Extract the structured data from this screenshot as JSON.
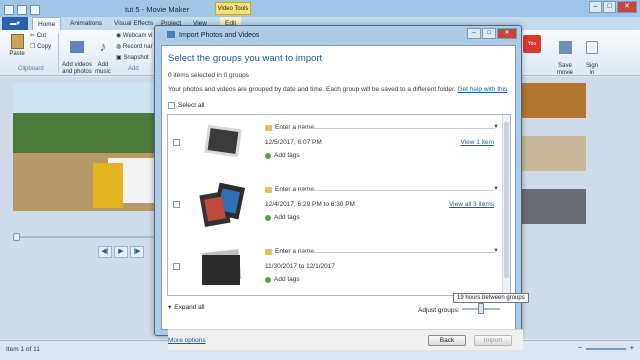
{
  "app": {
    "title": "tut 5 - Movie Maker",
    "video_tools": "Video Tools"
  },
  "tabs": [
    "Home",
    "Animations",
    "Visual Effects",
    "Project",
    "View",
    "Edit"
  ],
  "ribbon": {
    "paste": "Paste",
    "cut": "Cut",
    "copy": "Copy",
    "add_videos": "Add videos\nand photos",
    "add_music": "Add\nmusic",
    "webcam": "Webcam vi",
    "record": "Record nar",
    "snapshot": "Snapshot",
    "save_movie": "Save\nmovie",
    "sign_in": "Sign\nin",
    "clipboard_group": "Clipboard",
    "add_group": "Add"
  },
  "status": {
    "item": "Item 1 of 11"
  },
  "dialog": {
    "title": "Import Photos and Videos",
    "heading": "Select the groups you want to import",
    "selected": "0 items selected in 0 groups",
    "info": "Your photos and videos are grouped by date and time. Each group will be saved to a different folder.",
    "help_link": "Get help with this",
    "select_all": "Select all",
    "groups": [
      {
        "name_placeholder": "Enter a name",
        "date": "12/5/2017, 6:07 PM",
        "view_link": "View 1 item",
        "add_tags": "Add tags"
      },
      {
        "name_placeholder": "Enter a name",
        "date": "12/4/2017, 6:29 PM to 6:30 PM",
        "view_link": "View all 3 items",
        "add_tags": "Add tags"
      },
      {
        "name_placeholder": "Enter a name",
        "date": "11/30/2017 to 12/1/2017",
        "view_link": "",
        "add_tags": "Add tags"
      }
    ],
    "expand_all": "Expand all",
    "adjust_groups": "Adjust groups:",
    "tooltip": "19 hours between groups",
    "adjust_level": 0.5,
    "more_options": "More options",
    "back": "Back",
    "import": "Import"
  }
}
